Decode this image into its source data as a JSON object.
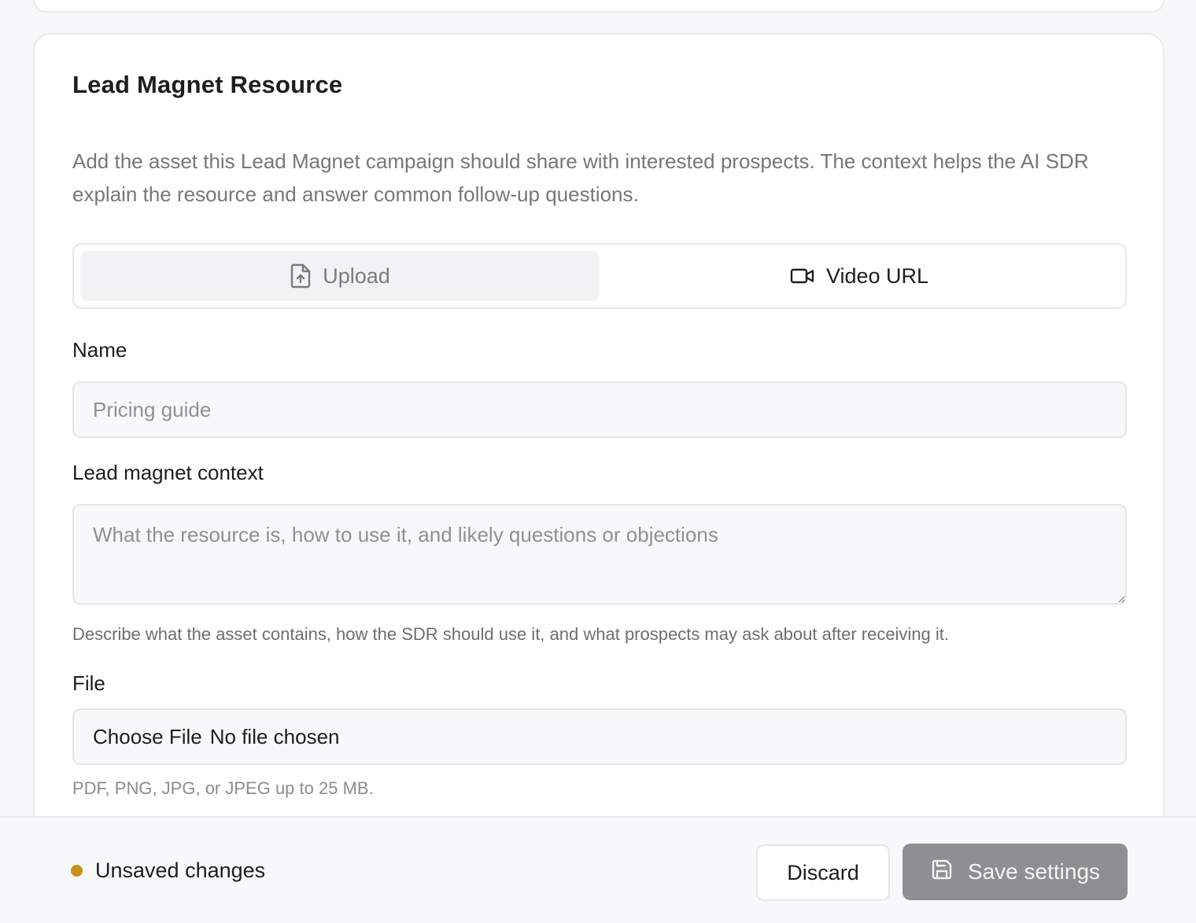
{
  "section": {
    "title": "Lead Magnet Resource",
    "description": "Add the asset this Lead Magnet campaign should share with interested prospects. The context helps the AI SDR explain the resource and answer common follow-up questions."
  },
  "source_tabs": [
    {
      "label": "Upload",
      "icon": "file-upload-icon",
      "active": true
    },
    {
      "label": "Video URL",
      "icon": "video-camera-icon",
      "active": false
    }
  ],
  "fields": {
    "name": {
      "label": "Name",
      "placeholder": "Pricing guide",
      "value": ""
    },
    "context": {
      "label": "Lead magnet context",
      "placeholder": "What the resource is, how to use it, and likely questions or objections",
      "value": "",
      "help": "Describe what the asset contains, how the SDR should use it, and what prospects may ask about after receiving it."
    },
    "file": {
      "label": "File",
      "button_label": "Choose File",
      "status": "No file chosen",
      "help": "PDF, PNG, JPG, or JPEG up to 25 MB."
    }
  },
  "footer": {
    "status": "Unsaved changes",
    "status_color": "#c8901a",
    "discard_label": "Discard",
    "save_label": "Save settings",
    "save_icon": "save-icon"
  },
  "colors": {
    "save_button_bg": "#8e8f91",
    "active_tab_bg": "#f1f2f4",
    "page_bg": "#f6f7f9"
  }
}
